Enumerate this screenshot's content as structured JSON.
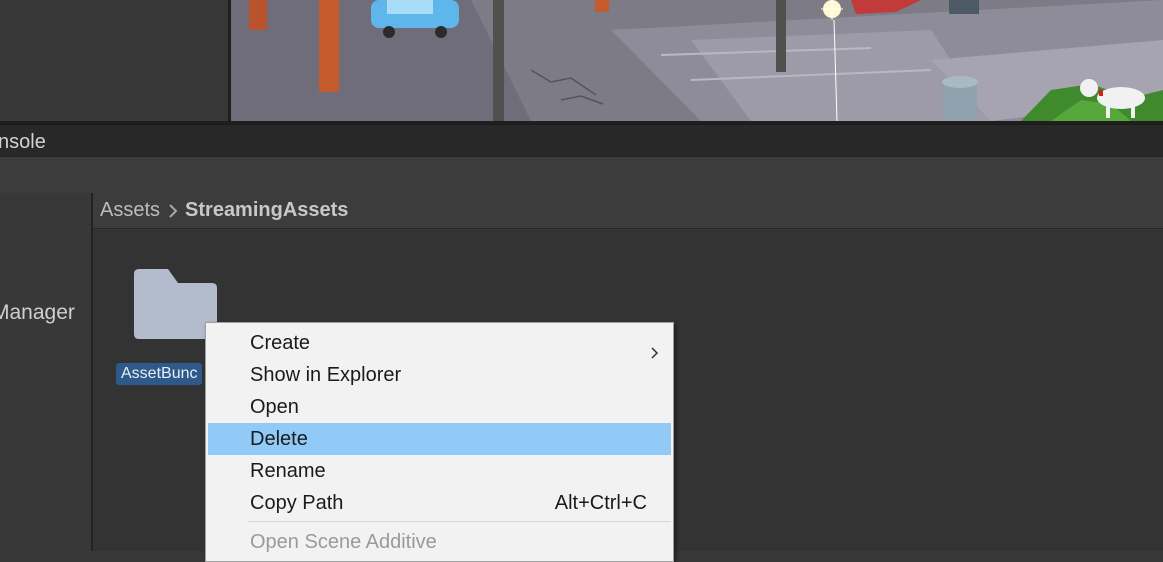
{
  "tabs": {
    "console": "nsole"
  },
  "left_panel": {
    "label": "Manager"
  },
  "breadcrumb": {
    "root": "Assets",
    "current": "StreamingAssets"
  },
  "assets": [
    {
      "name": "AssetBundles",
      "display": "AssetBunc",
      "icon": "folder-icon"
    }
  ],
  "context_menu": {
    "items": [
      {
        "label": "Create",
        "submenu": true
      },
      {
        "label": "Show in Explorer"
      },
      {
        "label": "Open"
      },
      {
        "label": "Delete",
        "highlighted": true
      },
      {
        "label": "Rename"
      },
      {
        "label": "Copy Path",
        "shortcut": "Alt+Ctrl+C"
      },
      {
        "label": "Open Scene Additive",
        "disabled": true
      }
    ]
  },
  "colors": {
    "menu_highlight": "#91c9f7",
    "selection": "#2d5a8a",
    "folder": "#b3bccc"
  }
}
